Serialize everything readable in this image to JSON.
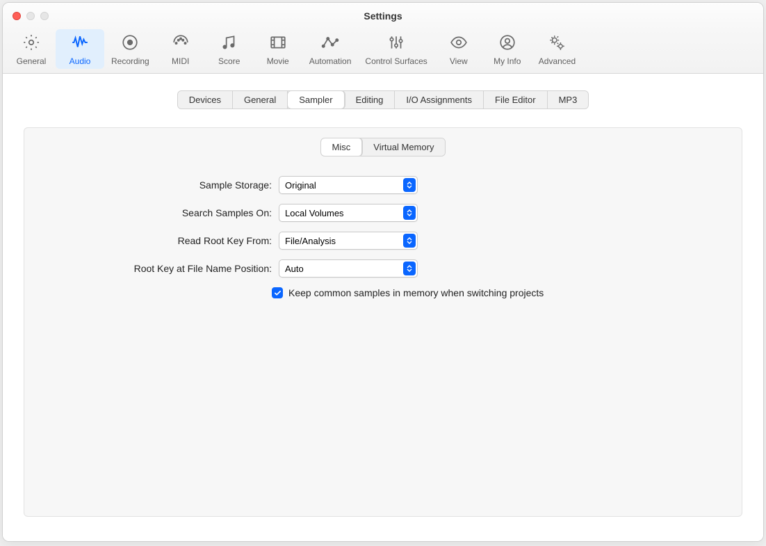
{
  "window": {
    "title": "Settings"
  },
  "toolbar": {
    "items": [
      {
        "label": "General"
      },
      {
        "label": "Audio"
      },
      {
        "label": "Recording"
      },
      {
        "label": "MIDI"
      },
      {
        "label": "Score"
      },
      {
        "label": "Movie"
      },
      {
        "label": "Automation"
      },
      {
        "label": "Control Surfaces"
      },
      {
        "label": "View"
      },
      {
        "label": "My Info"
      },
      {
        "label": "Advanced"
      }
    ],
    "selected": "Audio"
  },
  "tabs": {
    "items": [
      "Devices",
      "General",
      "Sampler",
      "Editing",
      "I/O Assignments",
      "File Editor",
      "MP3"
    ],
    "selected": "Sampler"
  },
  "subtabs": {
    "items": [
      "Misc",
      "Virtual Memory"
    ],
    "selected": "Misc"
  },
  "form": {
    "sample_storage_label": "Sample Storage:",
    "sample_storage_value": "Original",
    "search_samples_label": "Search Samples On:",
    "search_samples_value": "Local Volumes",
    "read_root_key_label": "Read Root Key From:",
    "read_root_key_value": "File/Analysis",
    "root_key_pos_label": "Root Key at File Name Position:",
    "root_key_pos_value": "Auto",
    "checkbox_label": "Keep common samples in memory when switching projects",
    "checkbox_checked": true
  }
}
